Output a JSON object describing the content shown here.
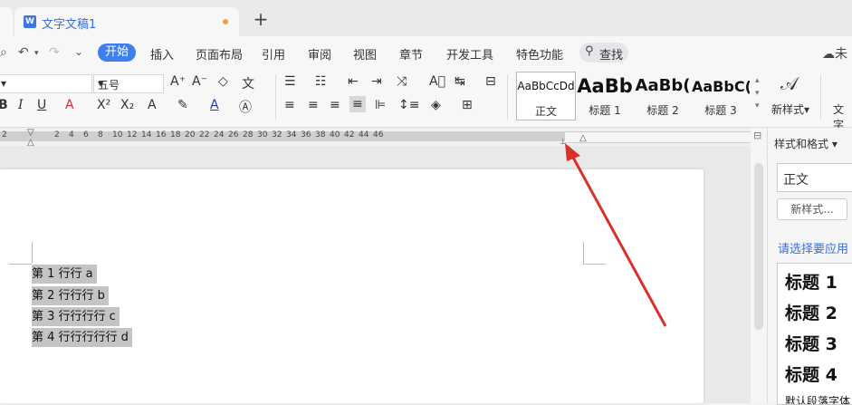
{
  "tabs": {
    "doc_title": "文字文稿1",
    "new_tab": "+"
  },
  "menu": {
    "items": [
      "开始",
      "插入",
      "页面布局",
      "引用",
      "审阅",
      "视图",
      "章节",
      "开发工具",
      "特色功能"
    ],
    "search": "查找",
    "cloud_label": "未"
  },
  "ribbon": {
    "font_size": "五号",
    "styles": [
      {
        "sample": "AaBbCcDd",
        "name": "正文"
      },
      {
        "sample": "AaBb",
        "name": "标题 1"
      },
      {
        "sample": "AaBb(",
        "name": "标题 2"
      },
      {
        "sample": "AaBbC(",
        "name": "标题 3"
      }
    ],
    "new_style": "新样式",
    "text_tool": "文字"
  },
  "ruler": {
    "labels": [
      "2",
      "2",
      "4",
      "6",
      "8",
      "10",
      "12",
      "14",
      "16",
      "18",
      "20",
      "22",
      "24",
      "26",
      "28",
      "30",
      "32",
      "34",
      "36",
      "38",
      "40",
      "42",
      "44",
      "46"
    ]
  },
  "document": {
    "lines": [
      "第 1 行行 a",
      "第 2 行行行 b",
      "第 3 行行行行 c",
      "第 4 行行行行行 d"
    ]
  },
  "pane": {
    "title": "样式和格式",
    "current_style": "正文",
    "new_style_button": "新样式...",
    "prompt": "请选择要应用",
    "styles": [
      "标题 1",
      "标题 2",
      "标题 3",
      "标题 4",
      "默认段落字体"
    ]
  },
  "colors": {
    "accent": "#3d7ff0",
    "annotation_arrow": "#d9302a",
    "selection": "#c4c4c4"
  }
}
